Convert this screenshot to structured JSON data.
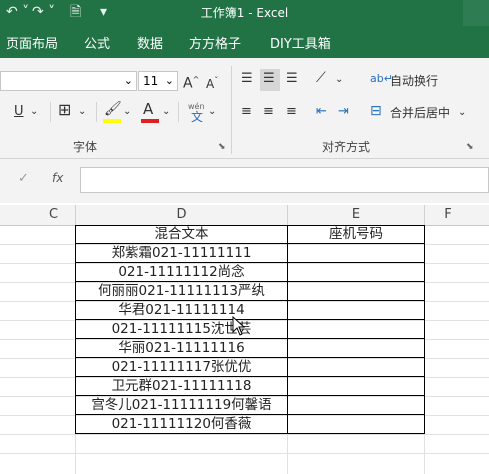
{
  "titlebar": {
    "title": "工作簿1 - Excel"
  },
  "tabs": [
    "页面布局",
    "公式",
    "数据",
    "方方格子",
    "DIY工具箱"
  ],
  "ribbon": {
    "font_size": "11",
    "grow_font": "A",
    "shrink_font": "A",
    "wrap_text": "自动换行",
    "merge_center": "合并后居中",
    "font_group": "字体",
    "align_group": "对齐方式",
    "phonetic": "wén"
  },
  "formula_bar": {
    "fx_label": "fx",
    "value": ""
  },
  "columns": [
    "C",
    "D",
    "E",
    "F"
  ],
  "table": {
    "headers": [
      "混合文本",
      "座机号码"
    ],
    "rows": [
      [
        "郑紫霜021-11111111",
        ""
      ],
      [
        "021-11111112尚念",
        ""
      ],
      [
        "何丽丽021-11111113严纨",
        ""
      ],
      [
        "华君021-11111114",
        ""
      ],
      [
        "021-11111115沈世芸",
        ""
      ],
      [
        "华丽021-11111116",
        ""
      ],
      [
        "021-11111117张优优",
        ""
      ],
      [
        "卫元群021-11111118",
        ""
      ],
      [
        "宫冬儿021-11111119何馨语",
        ""
      ],
      [
        "021-11111120何香薇",
        ""
      ]
    ]
  },
  "colors": {
    "excel_green": "#217346",
    "highlight_yellow": "#ffff00",
    "font_red": "#e02020"
  }
}
